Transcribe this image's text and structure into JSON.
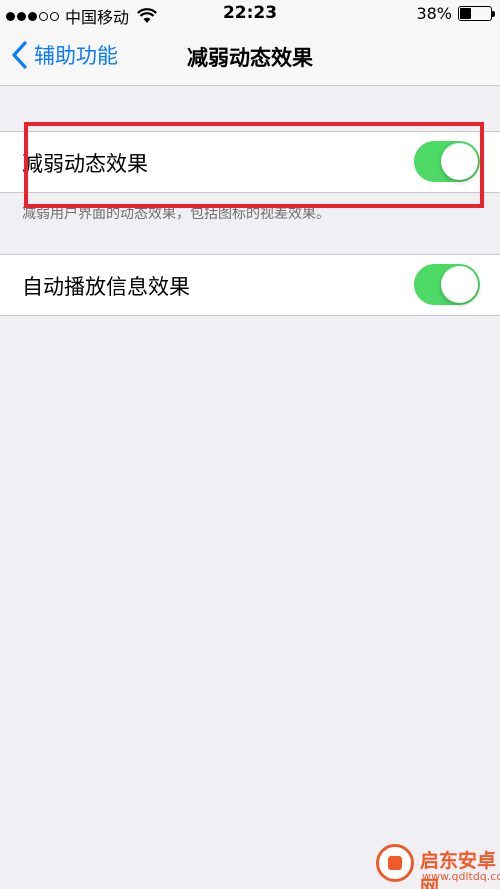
{
  "status_bar": {
    "carrier": "中国移动",
    "time": "22:23",
    "battery_percent": "38%",
    "battery_level": 0.38,
    "signal_filled": 3,
    "signal_total": 5
  },
  "nav": {
    "back_label": "辅助功能",
    "title": "减弱动态效果"
  },
  "settings": {
    "reduce_motion": {
      "label": "减弱动态效果",
      "on": true
    },
    "reduce_motion_footer": "减弱用户界面的动态效果，包括图标的视差效果。",
    "auto_play_message_effects": {
      "label": "自动播放信息效果",
      "on": true
    }
  },
  "watermark": {
    "name": "启东安卓网",
    "url": "www.qdltdq.com"
  },
  "colors": {
    "accent": "#0a7aff",
    "toggle_on": "#4cd964",
    "highlight": "#e8232b",
    "background": "#efeff4"
  }
}
